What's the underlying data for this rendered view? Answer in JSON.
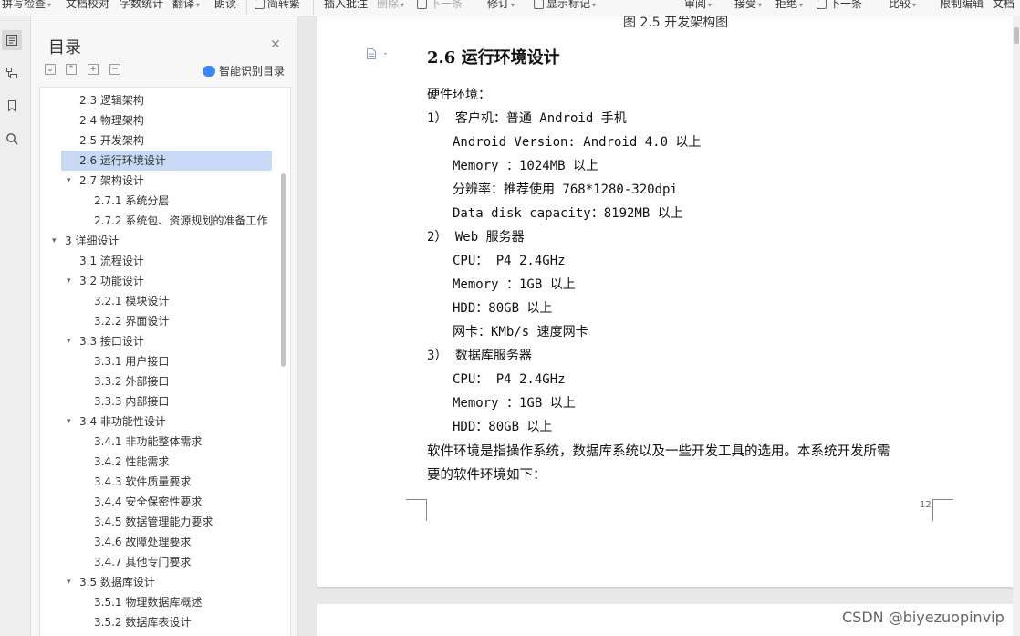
{
  "toolbar": {
    "items": [
      {
        "label": "拼写检查"
      },
      {
        "label": "文档校对"
      },
      {
        "label": "字数统计"
      },
      {
        "label": "翻译"
      },
      {
        "label": "朗读"
      },
      {
        "label": "简转繁"
      },
      {
        "label": "插入批注"
      },
      {
        "label": "删除"
      },
      {
        "label": "下一条"
      },
      {
        "label": "修订"
      },
      {
        "label": "显示标记"
      },
      {
        "label": "审阅"
      },
      {
        "label": "接受"
      },
      {
        "label": "拒绝"
      },
      {
        "label": "下一条"
      },
      {
        "label": "比较"
      },
      {
        "label": "限制编辑"
      },
      {
        "label": "文档"
      }
    ]
  },
  "toc": {
    "title": "目录",
    "smart_label": "智能识别目录",
    "items": [
      {
        "label": "2.3 逻辑架构"
      },
      {
        "label": "2.4  物理架构"
      },
      {
        "label": "2.5 开发架构"
      },
      {
        "label": "2.6 运行环境设计"
      },
      {
        "label": "2.7 架构设计"
      },
      {
        "label": "2.7.1 系统分层"
      },
      {
        "label": "2.7.2 系统包、资源规划的准备工作"
      },
      {
        "label": "3  详细设计"
      },
      {
        "label": "3.1  流程设计"
      },
      {
        "label": "3.2 功能设计"
      },
      {
        "label": "3.2.1 模块设计"
      },
      {
        "label": "3.2.2 界面设计"
      },
      {
        "label": "3.3 接口设计"
      },
      {
        "label": "3.3.1 用户接口"
      },
      {
        "label": "3.3.2 外部接口"
      },
      {
        "label": "3.3.3 内部接口"
      },
      {
        "label": "3.4 非功能性设计"
      },
      {
        "label": "3.4.1  非功能整体需求"
      },
      {
        "label": "3.4.2  性能需求"
      },
      {
        "label": "3.4.3  软件质量要求"
      },
      {
        "label": "3.4.4  安全保密性要求"
      },
      {
        "label": "3.4.5  数据管理能力要求"
      },
      {
        "label": "3.4.6  故障处理要求"
      },
      {
        "label": "3.4.7  其他专门要求"
      },
      {
        "label": "3.5  数据库设计"
      },
      {
        "label": "3.5.1 物理数据库概述"
      },
      {
        "label": "3.5.2 数据库表设计"
      }
    ]
  },
  "document": {
    "caption": "图 2.5 开发架构图",
    "heading": "2.6 运行环境设计",
    "lines": [
      "硬件环境：",
      "1） 客户机：普通 Android 手机",
      "Android Version: Android 4.0 以上",
      "Memory ：1024MB 以上",
      "分辨率：推荐使用 768*1280-320dpi",
      "Data disk capacity：8192MB 以上",
      "2） Web 服务器",
      "CPU：  P4 2.4GHz",
      "Memory ：1GB 以上",
      "HDD：80GB 以上",
      "网卡：KMb/s 速度网卡",
      "3） 数据库服务器",
      "CPU：  P4 2.4GHz",
      "Memory ：1GB 以上",
      "HDD：80GB 以上",
      "软件环境是指操作系统，数据库系统以及一些开发工具的选用。本系统开发所需",
      "要的软件环境如下："
    ],
    "page_number": "12"
  },
  "watermark": "CSDN @biyezuopinvip"
}
